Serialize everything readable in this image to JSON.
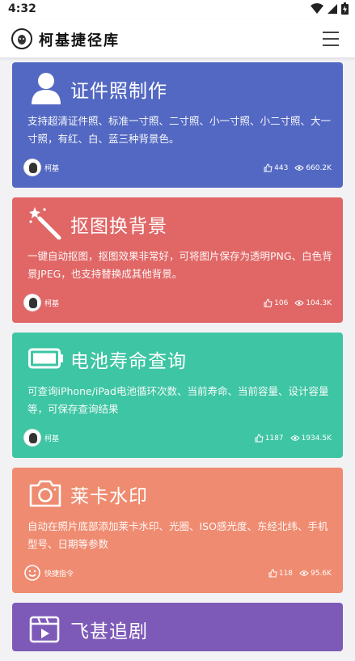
{
  "status_bar": {
    "time": "4:32"
  },
  "app": {
    "title": "柯基捷径库"
  },
  "cards": [
    {
      "title": "证件照制作",
      "description": "支持超清证件照、标准一寸照、二寸照、小一寸照、小二寸照、大一寸照，有红、白、蓝三种背景色。",
      "author": "柯基",
      "likes": "443",
      "views": "660.2K",
      "icon": "person-icon",
      "color": "#5368c2"
    },
    {
      "title": "抠图换背景",
      "description": "一键自动抠图，抠图效果非常好，可将图片保存为透明PNG、白色背景JPEG，也支持替换成其他背景。",
      "author": "柯基",
      "likes": "106",
      "views": "104.3K",
      "icon": "magic-wand-icon",
      "color": "#e06766"
    },
    {
      "title": "电池寿命查询",
      "description": "可查询iPhone/iPad电池循环次数、当前寿命、当前容量、设计容量等，可保存查询结果",
      "author": "柯基",
      "likes": "1187",
      "views": "1934.5K",
      "icon": "battery-icon",
      "color": "#3ec5a4"
    },
    {
      "title": "莱卡水印",
      "description": "自动在照片底部添加莱卡水印、光圈、ISO感光度、东经北纬、手机型号、日期等参数",
      "author": "快捷指令",
      "likes": "118",
      "views": "95.6K",
      "icon": "camera-icon",
      "color": "#ef8b70"
    },
    {
      "title": "飞甚追剧",
      "icon": "video-icon",
      "color": "#7d5ab8"
    }
  ]
}
